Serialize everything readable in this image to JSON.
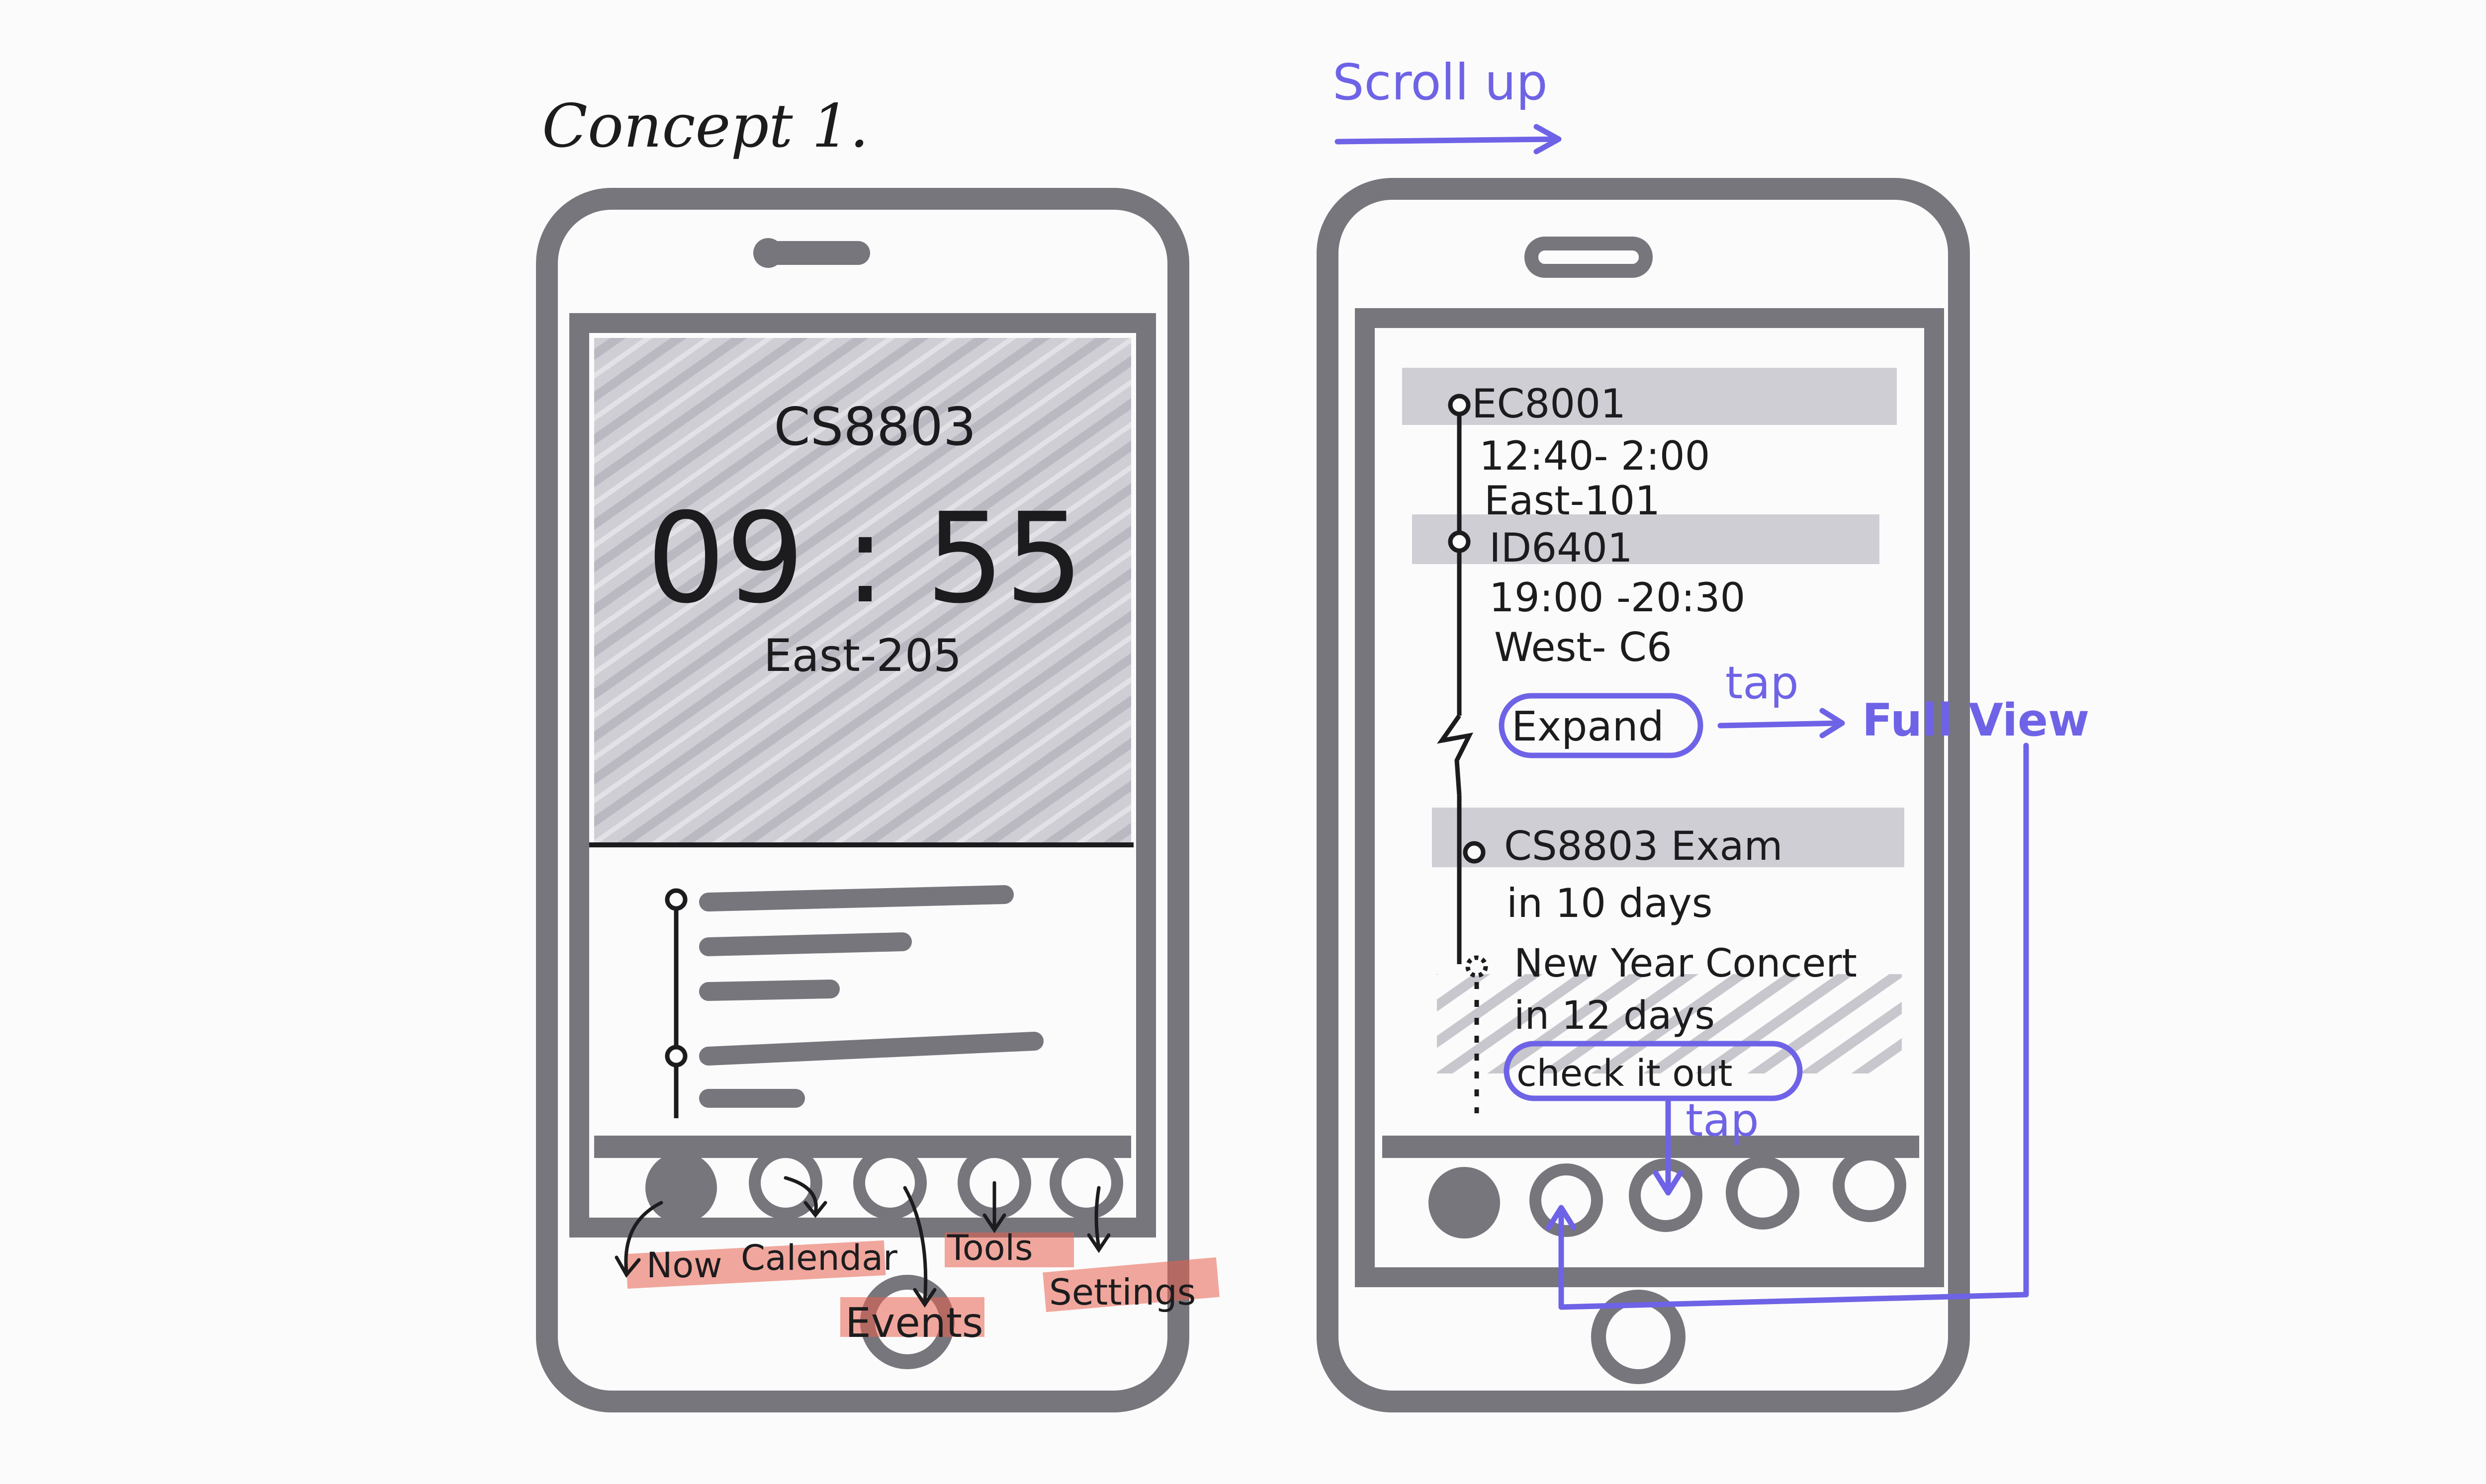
{
  "title": "Concept 1.",
  "annotations": {
    "scroll_up": "Scroll up",
    "tap_expand": "tap",
    "full_view": "Full View",
    "tap_check": "tap"
  },
  "phone_left": {
    "hero": {
      "course": "CS8803",
      "time": "09 : 55",
      "location": "East-205"
    },
    "tab_labels": {
      "now": "Now",
      "calendar": "Calendar",
      "events": "Events",
      "tools": "Tools",
      "settings": "Settings"
    }
  },
  "phone_right": {
    "schedule": [
      {
        "course": "EC8001",
        "time": "12:40- 2:00",
        "room": "East-101"
      },
      {
        "course": "ID6401",
        "time": "19:00 -20:30",
        "room": "West- C6"
      }
    ],
    "expand_label": "Expand",
    "events": [
      {
        "title": "CS8803 Exam",
        "when": "in 10 days"
      },
      {
        "title": "New Year Concert",
        "when": "in 12 days"
      }
    ],
    "check_label": "check it out"
  },
  "colors": {
    "marker_grey": "#77767d",
    "ink": "#1c1c1e",
    "annotation_blue": "#6e63e6",
    "highlight_red": "#e8604f",
    "shade": "#c9c8cf"
  }
}
